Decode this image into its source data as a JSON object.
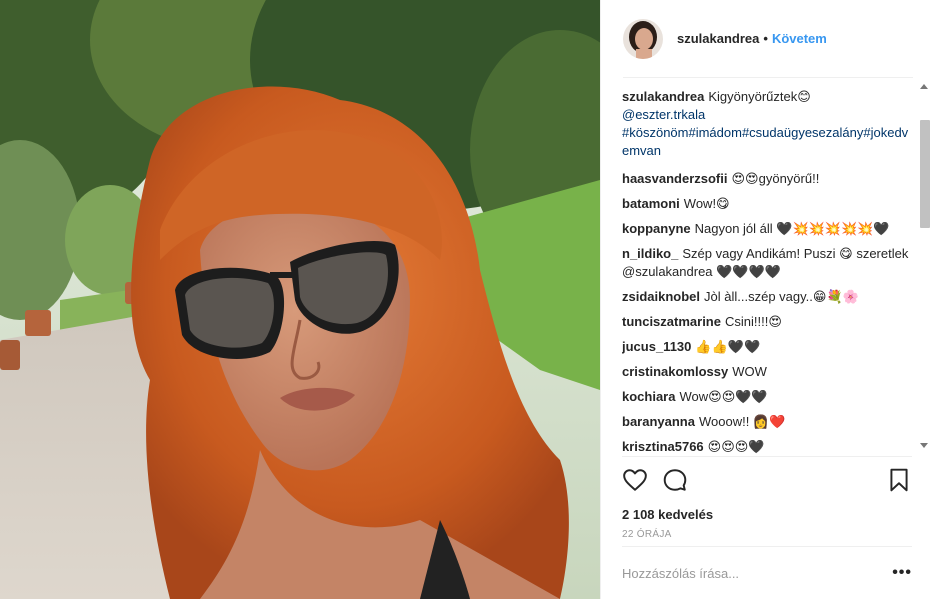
{
  "header": {
    "username": "szulakandrea",
    "separator": "•",
    "follow_label": "Követem"
  },
  "caption": {
    "username": "szulakandrea",
    "text": "Kigyönyörűztek😊",
    "mention": "@eszter.trkala",
    "hashtags": "#köszönöm#imádom#csudaügyesezalány#jokedvemvan"
  },
  "comments": [
    {
      "user": "haasvanderzsofii",
      "text": "😍😍gyönyörű!!"
    },
    {
      "user": "batamoni",
      "text": "Wow!😋"
    },
    {
      "user": "koppanyne",
      "text": "Nagyon jól áll 🖤💥💥💥💥💥🖤"
    },
    {
      "user": "n_ildiko_",
      "text": "Szép vagy Andikám! Puszi 😋 szeretlek @szulakandrea 🖤🖤🖤🖤"
    },
    {
      "user": "zsidaiknobel",
      "text": "Jòl àll...szép vagy..😁💐🌸"
    },
    {
      "user": "tunciszatmarine",
      "text": "Csini!!!!😍"
    },
    {
      "user": "jucus_1130",
      "text": "👍👍🖤🖤"
    },
    {
      "user": "cristinakomlossy",
      "text": "WOW"
    },
    {
      "user": "kochiara",
      "text": "Wow😍😍🖤🖤"
    },
    {
      "user": "baranyanna",
      "text": "Wooow!! 👩‍❤️"
    },
    {
      "user": "krisztina5766",
      "text": "😍😍😍🖤"
    }
  ],
  "actions": {
    "like_icon": "heart-icon",
    "comment_icon": "comment-icon",
    "save_icon": "bookmark-icon"
  },
  "likes_text": "2 108 kedvelés",
  "time_text": "22 ÓRÁJA",
  "add_comment": {
    "placeholder": "Hozzászólás írása...",
    "more_label": "•••"
  },
  "colors": {
    "link": "#3897f0",
    "hashtag": "#003569",
    "muted": "#999999",
    "border": "#efefef"
  }
}
